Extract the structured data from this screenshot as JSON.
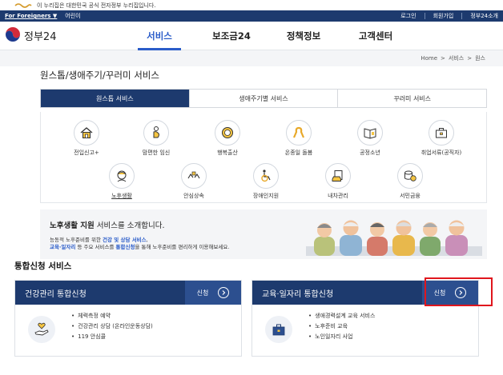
{
  "gov_banner": {
    "text": "이 누리집은 대한민국 공식 전자정부 누리집입니다."
  },
  "util": {
    "foreigners": "For Foreigners ▼",
    "kids": "어린이",
    "login": "로그인",
    "join": "회원가입",
    "intro": "정부24소개"
  },
  "brand": {
    "name": "정부24"
  },
  "gnb": [
    "서비스",
    "보조금24",
    "정책정보",
    "고객센터"
  ],
  "breadcrumb": [
    "Home",
    ">",
    "서비스",
    ">",
    "원스"
  ],
  "page_title": "원스톱/생애주기/꾸러미 서비스",
  "tabs": [
    "원스톱 서비스",
    "생애주기별 서비스",
    "꾸러미 서비스"
  ],
  "services": [
    {
      "label": "전입신고+",
      "icon": "house-icon"
    },
    {
      "label": "맘편한 임신",
      "icon": "pregnant-icon"
    },
    {
      "label": "행복출산",
      "icon": "baby-icon"
    },
    {
      "label": "온종일 돌봄",
      "icon": "ribbon-icon"
    },
    {
      "label": "공정소년",
      "icon": "book-icon"
    },
    {
      "label": "취업서류(공직자)",
      "icon": "briefcase-icon"
    },
    {
      "label": "노후생활",
      "icon": "elderly-icon"
    },
    {
      "label": "안심상속",
      "icon": "hands-icon"
    },
    {
      "label": "장애인지원",
      "icon": "wheelchair-icon"
    },
    {
      "label": "내차관리",
      "icon": "car-doc-icon"
    },
    {
      "label": "서민금융",
      "icon": "coins-icon"
    }
  ],
  "promo": {
    "title_bold": "노후생활 지원",
    "title_rest": " 서비스를 소개합니다.",
    "line1_a": "능동적 노후준비를 위한 ",
    "line1_hl": "건강 및 상담 서비스",
    "line1_b": ",",
    "line2_hl": "교육·일자리",
    "line2_a": " 등 주요 서비스를 ",
    "line2_hl2": "통합신청",
    "line2_b": "을 통해 노후준비를 편리하게 이용해보세요."
  },
  "section_title": "통합신청 서비스",
  "cards": [
    {
      "title": "건강관리 통합신청",
      "apply": "신청",
      "items": [
        "체력측정 예약",
        "건강관리 상담 (온라인운동상담)",
        "119 안심콜"
      ]
    },
    {
      "title": "교육·일자리 통합신청",
      "apply": "신청",
      "items": [
        "생애경력설계 교육 서비스",
        "노후준비 교육",
        "노인일자리 사업"
      ]
    }
  ],
  "colors": {
    "navy": "#1d3a6e",
    "accent_blue": "#2a5cc9",
    "highlight_red": "#e0161d"
  }
}
